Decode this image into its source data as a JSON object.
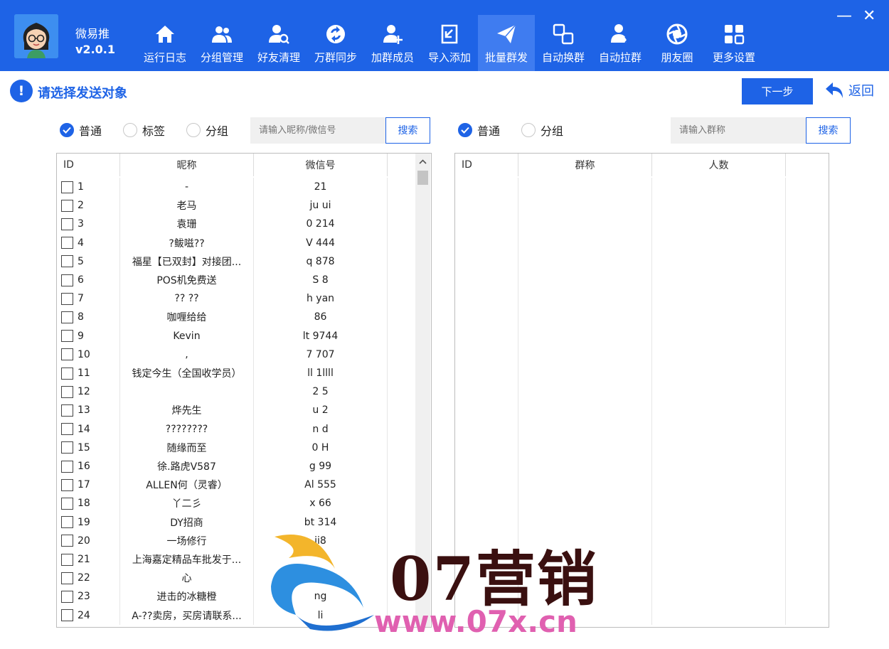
{
  "app": {
    "name": "微易推",
    "version": "v2.0.1"
  },
  "nav": [
    {
      "label": "运行日志",
      "icon": "home-icon"
    },
    {
      "label": "分组管理",
      "icon": "users-icon"
    },
    {
      "label": "好友清理",
      "icon": "user-search-icon"
    },
    {
      "label": "万群同步",
      "icon": "sync-icon"
    },
    {
      "label": "加群成员",
      "icon": "user-add-icon"
    },
    {
      "label": "导入添加",
      "icon": "import-icon"
    },
    {
      "label": "批量群发",
      "icon": "send-icon",
      "active": true
    },
    {
      "label": "自动换群",
      "icon": "switch-icon"
    },
    {
      "label": "自动拉群",
      "icon": "user-pull-icon"
    },
    {
      "label": "朋友圈",
      "icon": "moments-icon"
    },
    {
      "label": "更多设置",
      "icon": "grid-icon"
    }
  ],
  "window": {
    "minimize": "—",
    "close": "✕"
  },
  "header": {
    "title": "请选择发送对象",
    "next_label": "下一步",
    "back_label": "返回"
  },
  "left": {
    "radios": [
      {
        "label": "普通",
        "checked": true
      },
      {
        "label": "标签",
        "checked": false
      },
      {
        "label": "分组",
        "checked": false
      }
    ],
    "search_placeholder": "请输入昵称/微信号",
    "search_label": "搜索",
    "columns": [
      "ID",
      "昵称",
      "微信号"
    ],
    "rows": [
      {
        "id": "1",
        "nickname": "-",
        "wxid": "21"
      },
      {
        "id": "2",
        "nickname": "老马",
        "wxid": "ju     ui"
      },
      {
        "id": "3",
        "nickname": "袁珊",
        "wxid": "0     214"
      },
      {
        "id": "4",
        "nickname": "?鲅嗞??",
        "wxid": "V      444"
      },
      {
        "id": "5",
        "nickname": "福星【已双封】对接团...",
        "wxid": "q      878"
      },
      {
        "id": "6",
        "nickname": "POS机免费送",
        "wxid": "S    8"
      },
      {
        "id": "7",
        "nickname": "?? ??",
        "wxid": "h     yan"
      },
      {
        "id": "8",
        "nickname": "咖喱给给",
        "wxid": "86"
      },
      {
        "id": "9",
        "nickname": "Kevin",
        "wxid": "lt      9744"
      },
      {
        "id": "10",
        "nickname": ",",
        "wxid": "7      707"
      },
      {
        "id": "11",
        "nickname": "钱定今生（全国收学员）",
        "wxid": "ll      1llll"
      },
      {
        "id": "12",
        "nickname": "",
        "wxid": "2     5"
      },
      {
        "id": "13",
        "nickname": "烨先生",
        "wxid": "u    2"
      },
      {
        "id": "14",
        "nickname": "????????",
        "wxid": "n    d"
      },
      {
        "id": "15",
        "nickname": "随缘而至",
        "wxid": "0     H"
      },
      {
        "id": "16",
        "nickname": "徐.路虎V587",
        "wxid": "g     99"
      },
      {
        "id": "17",
        "nickname": "ALLEN何（灵睿）",
        "wxid": "Al      555"
      },
      {
        "id": "18",
        "nickname": "丫二彡",
        "wxid": "x     66"
      },
      {
        "id": "19",
        "nickname": "DY招商",
        "wxid": "bt     314"
      },
      {
        "id": "20",
        "nickname": "一场修行",
        "wxid": "ji8"
      },
      {
        "id": "21",
        "nickname": "上海嘉定精品车批发于...",
        "wxid": ""
      },
      {
        "id": "22",
        "nickname": "心",
        "wxid": ""
      },
      {
        "id": "23",
        "nickname": "进击的冰糖橙",
        "wxid": "ng"
      },
      {
        "id": "24",
        "nickname": "A-??卖房，买房请联系...",
        "wxid": "li"
      }
    ]
  },
  "right": {
    "radios": [
      {
        "label": "普通",
        "checked": true
      },
      {
        "label": "分组",
        "checked": false
      }
    ],
    "search_placeholder": "请输入群称",
    "search_label": "搜索",
    "columns": [
      "ID",
      "群称",
      "人数"
    ]
  },
  "watermark": {
    "text": "07营销",
    "url": "www.07x.cn"
  }
}
